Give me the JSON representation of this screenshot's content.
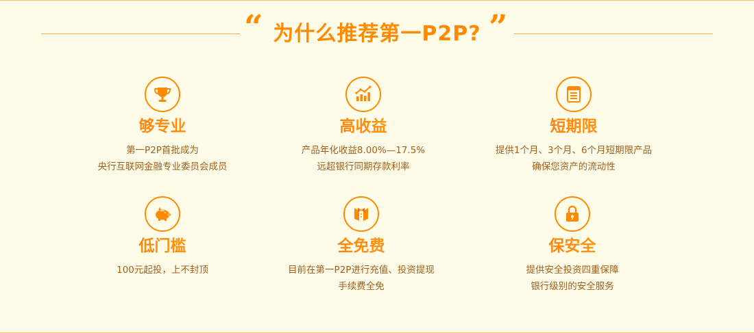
{
  "header": {
    "title": "为什么推荐第一P2P?",
    "open_quote": "“",
    "close_quote": "”"
  },
  "colors": {
    "accent": "#ff8a00",
    "text": "#a0601c",
    "background": "#fffbe9",
    "line": "#f6b04f"
  },
  "features": [
    {
      "icon": "trophy-icon",
      "title": "够专业",
      "lines": [
        "第一P2P首批成为",
        "央行互联网金融专业委员会成员"
      ]
    },
    {
      "icon": "growth-chart-icon",
      "title": "高收益",
      "lines": [
        "产品年化收益8.00%—17.5%",
        "远超银行同期存款利率"
      ]
    },
    {
      "icon": "document-icon",
      "title": "短期限",
      "lines": [
        "提供1个月、3个月、6个月短期限产品",
        "确保您资产的流动性"
      ]
    },
    {
      "icon": "piggy-bank-icon",
      "title": "低门槛",
      "lines": [
        "100元起投，上不封顶"
      ]
    },
    {
      "icon": "bow-tie-icon",
      "title": "全免费",
      "lines": [
        "目前在第一P2P进行充值、投资提现",
        "手续费全免"
      ]
    },
    {
      "icon": "padlock-icon",
      "title": "保安全",
      "lines": [
        "提供安全投资四重保障",
        "银行级别的安全服务"
      ]
    }
  ]
}
